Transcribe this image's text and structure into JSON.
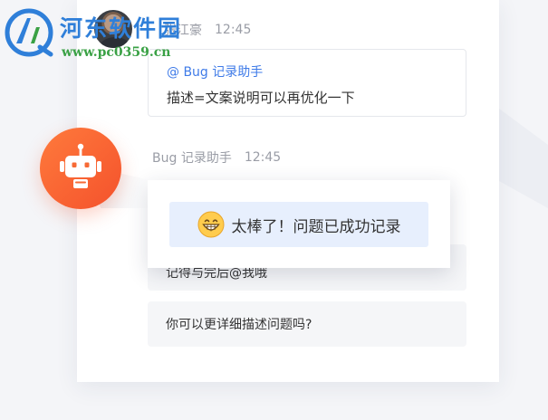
{
  "watermark": {
    "title": "河东软件园",
    "url": "www.pc0359.cn"
  },
  "message_user": {
    "sender": "张江豪",
    "time": "12:45",
    "mention": "@ Bug 记录助手",
    "text": "描述=文案说明可以再优化一下"
  },
  "message_bot": {
    "sender": "Bug 记录助手",
    "time": "12:45",
    "partial_text": "记得与完后@我哦",
    "question": "你可以更详细描述问题吗?"
  },
  "toast": {
    "text": "太棒了！问题已成功记录",
    "icon": "grinning-face-icon"
  },
  "colors": {
    "accent_blue": "#3f7be8",
    "robot_orange": "#f4522c",
    "toast_bg": "#e7effd"
  }
}
